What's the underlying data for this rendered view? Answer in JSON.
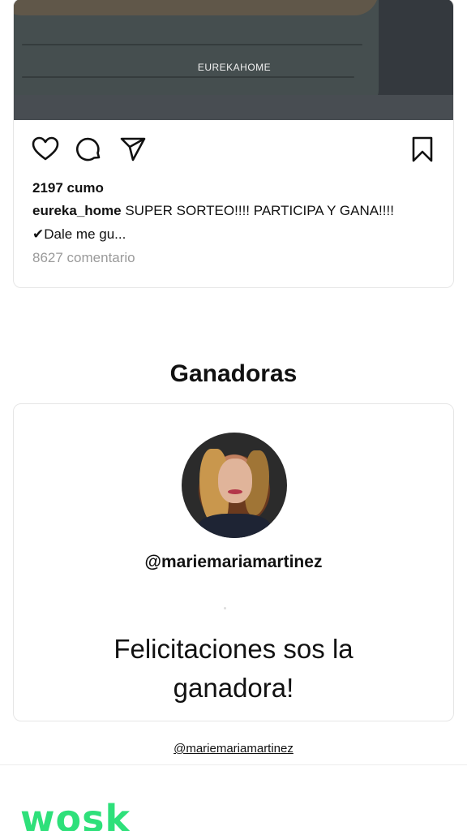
{
  "post": {
    "image_caption": "EUREKAHOME",
    "likes": "2197 cumo",
    "username": "eureka_home",
    "caption": " SUPER SORTEO!!!! PARTICIPA Y GANA!!!!",
    "caption_more": "✔Dale me gu...",
    "comments": "8627 comentario",
    "icons": [
      "heart-icon",
      "comment-icon",
      "share-icon",
      "bookmark-icon"
    ]
  },
  "winners": {
    "title": "Ganadoras",
    "handle": "@mariemariamartinez",
    "message_line1": "Felicitaciones sos la",
    "message_line2": "ganadora!"
  },
  "footer": {
    "link": "@mariemariamartinez",
    "brand": "wosk",
    "brand_color": "#2ee07a"
  }
}
